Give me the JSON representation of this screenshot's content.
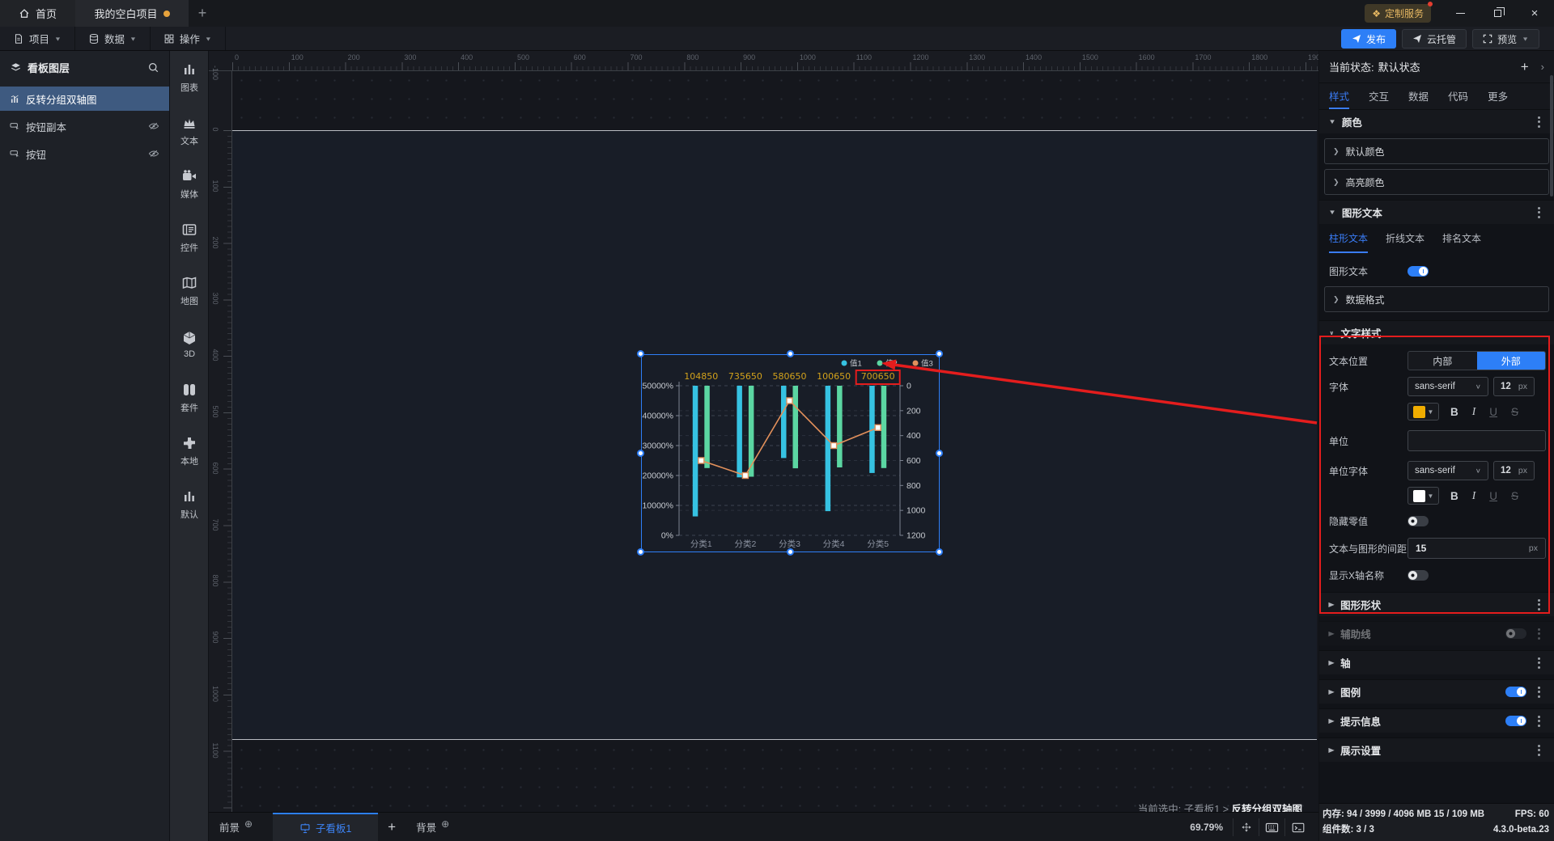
{
  "titlebar": {
    "home_tab": "首页",
    "project_tab": "我的空白项目",
    "new_tab_button": "+",
    "badge": "定制服务",
    "close_glyph": "×"
  },
  "menubar": {
    "project": "项目",
    "data": "数据",
    "action": "操作",
    "publish": "发布",
    "cloud": "云托管",
    "preview": "预览"
  },
  "layers_panel": {
    "title": "看板图层",
    "items": [
      {
        "label": "反转分组双轴图",
        "selected": true,
        "hidden": false,
        "icon": "chart"
      },
      {
        "label": "按钮副本",
        "selected": false,
        "hidden": true,
        "icon": "button"
      },
      {
        "label": "按钮",
        "selected": false,
        "hidden": true,
        "icon": "button"
      }
    ]
  },
  "rail": {
    "items": [
      "图表",
      "文本",
      "媒体",
      "控件",
      "地图",
      "3D",
      "套件",
      "本地",
      "默认"
    ]
  },
  "canvas": {
    "zoom_percent": "69.79%",
    "hint_prefix": "当前选中:",
    "hint_board": "子看板1",
    "hint_separator": ">",
    "hint_component": "反转分组双轴图",
    "ruler": {
      "h_start": 0,
      "h_end": 1900,
      "v_start": -100,
      "v_end": 1100,
      "step": 100,
      "scale": 0.6979
    }
  },
  "bottom_bar": {
    "front_tab": "前景",
    "board_tab": "子看板1",
    "add_button": "+",
    "back_tab": "背景"
  },
  "inspector": {
    "state_label": "当前状态:",
    "state_value": "默认状态",
    "tabs": [
      "样式",
      "交互",
      "数据",
      "代码",
      "更多"
    ],
    "active_tab": "样式",
    "color_section": {
      "title": "颜色",
      "default_item": "默认颜色",
      "highlight_item": "高亮颜色"
    },
    "graph_text_section": {
      "title": "图形文本",
      "tabs": [
        "柱形文本",
        "折线文本",
        "排名文本"
      ],
      "active_tab": "柱形文本",
      "toggle_label": "图形文本",
      "toggle_on": true,
      "data_format_item": "数据格式",
      "text_style": {
        "title": "文字样式",
        "position_label": "文本位置",
        "position_inner": "内部",
        "position_outer": "外部",
        "position_selected": "外部",
        "font_label": "字体",
        "font_value": "sans-serif",
        "font_size": "12",
        "px_suffix": "px",
        "font_color": "#f0ad00",
        "bold": "B",
        "italic": "I",
        "underline": "U",
        "strike": "S",
        "unit_label": "单位",
        "unit_value": "",
        "unit_font_label": "单位字体",
        "unit_font_value": "sans-serif",
        "unit_font_size": "12",
        "unit_font_color": "#ffffff",
        "hide_zero_label": "隐藏零值",
        "hide_zero_on": false,
        "gap_label": "文本与图形的间距",
        "gap_value": "15",
        "show_x_axis_label": "显示X轴名称",
        "show_x_axis_on": false
      }
    },
    "bottom_sections": [
      {
        "title": "图形形状",
        "toggle": null,
        "disabled": false
      },
      {
        "title": "辅助线",
        "toggle": "off",
        "disabled": true
      },
      {
        "title": "轴",
        "toggle": null,
        "disabled": false
      },
      {
        "title": "图例",
        "toggle": "on",
        "disabled": false
      },
      {
        "title": "提示信息",
        "toggle": "on",
        "disabled": false
      },
      {
        "title": "展示设置",
        "toggle": null,
        "disabled": false
      }
    ]
  },
  "status_bar": {
    "memory_label": "内存:",
    "memory_value": "94 / 3999 / 4096 MB  15 / 109 MB",
    "fps_label": "FPS:",
    "fps_value": "60",
    "components_label": "组件数:",
    "components_value": "3 / 3",
    "version": "4.3.0-beta.23"
  },
  "chart_data": {
    "type": "bar",
    "subtype": "inverted-grouped-bars-with-line, dual axis",
    "categories": [
      "分类1",
      "分类2",
      "分类3",
      "分类4",
      "分类5"
    ],
    "series": [
      {
        "name": "值1",
        "type": "bar",
        "axis": "right",
        "color": "#36c2e2",
        "values": [
          1048,
          735,
          580,
          1006,
          700
        ]
      },
      {
        "name": "值2",
        "type": "bar",
        "axis": "right",
        "color": "#5bd6a2",
        "values": [
          660,
          730,
          662,
          655,
          660
        ]
      },
      {
        "name": "值3",
        "type": "line",
        "axis": "left",
        "color": "#e2905b",
        "values": [
          250,
          200,
          450,
          300,
          360
        ]
      }
    ],
    "bar_labels": [
      "104850",
      "735650",
      "580650",
      "100650",
      "700650"
    ],
    "bar_label_color": "#d3a21b",
    "highlighted_label_index": 4,
    "left_axis": {
      "ticks": [
        "50000%",
        "40000%",
        "30000%",
        "20000%",
        "10000%",
        "0%"
      ],
      "max": 50000,
      "value_to_pct": 100
    },
    "right_axis": {
      "ticks": [
        "0",
        "200",
        "400",
        "600",
        "800",
        "1000",
        "1200"
      ],
      "max": 1200,
      "inverted": true
    },
    "legend_position": "top-right",
    "grid": "dashed"
  }
}
